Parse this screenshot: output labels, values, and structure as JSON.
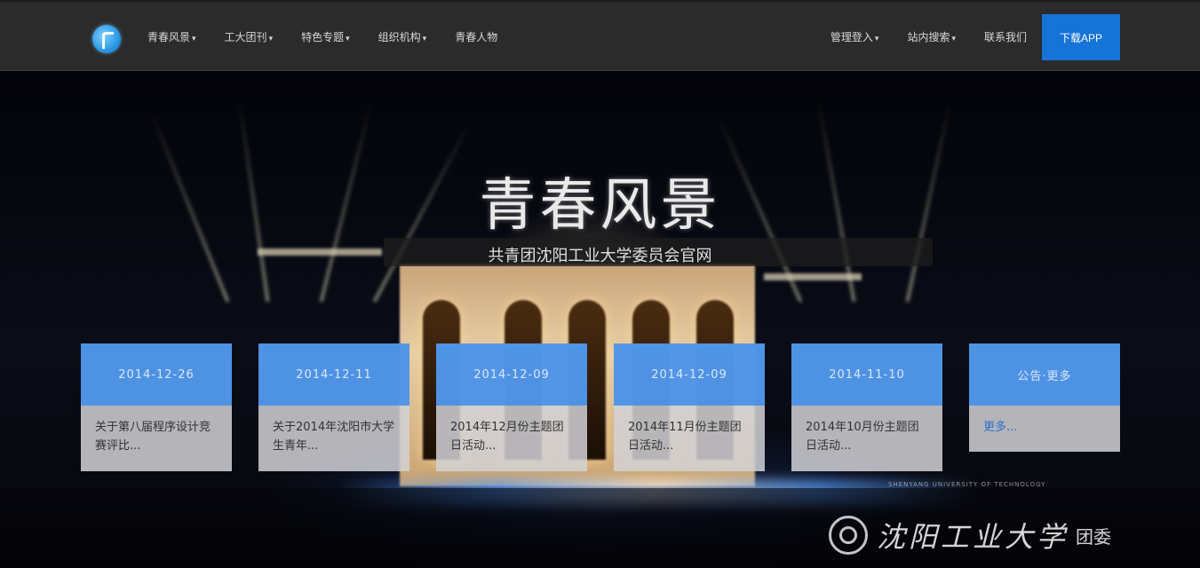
{
  "header": {
    "nav_left": [
      {
        "label": "青春风景",
        "caret": "▾"
      },
      {
        "label": "工大团刊",
        "caret": "▾"
      },
      {
        "label": "特色专题",
        "caret": "▾"
      },
      {
        "label": "组织机构",
        "caret": "▾"
      },
      {
        "label": "青春人物",
        "caret": ""
      }
    ],
    "nav_right": [
      {
        "label": "管理登入",
        "caret": "▾"
      },
      {
        "label": "站内搜索",
        "caret": "▾"
      },
      {
        "label": "联系我们",
        "caret": ""
      }
    ],
    "app_button": "下载APP"
  },
  "hero": {
    "title": "青春风景",
    "subtitle": "共青团沈阳工业大学委员会官网"
  },
  "cards": [
    {
      "date": "2014-12-26",
      "text": "关于第八届程序设计竞赛评比..."
    },
    {
      "date": "2014-12-11",
      "text": "关于2014年沈阳市大学生青年..."
    },
    {
      "date": "2014-12-09",
      "text": "2014年12月份主题团日活动..."
    },
    {
      "date": "2014-12-09",
      "text": "2014年11月份主题团日活动..."
    },
    {
      "date": "2014-11-10",
      "text": "2014年10月份主题团日活动..."
    },
    {
      "date": "公告·更多",
      "text": "更多..."
    }
  ],
  "footer": {
    "university_name": "沈阳工业大学",
    "unit": "团委",
    "english": "SHENYANG UNIVERSITY OF TECHNOLOGY"
  },
  "colors": {
    "header_bg": "#2b2b2b",
    "accent": "#1673d8",
    "card_header": "#3c8ceb"
  }
}
